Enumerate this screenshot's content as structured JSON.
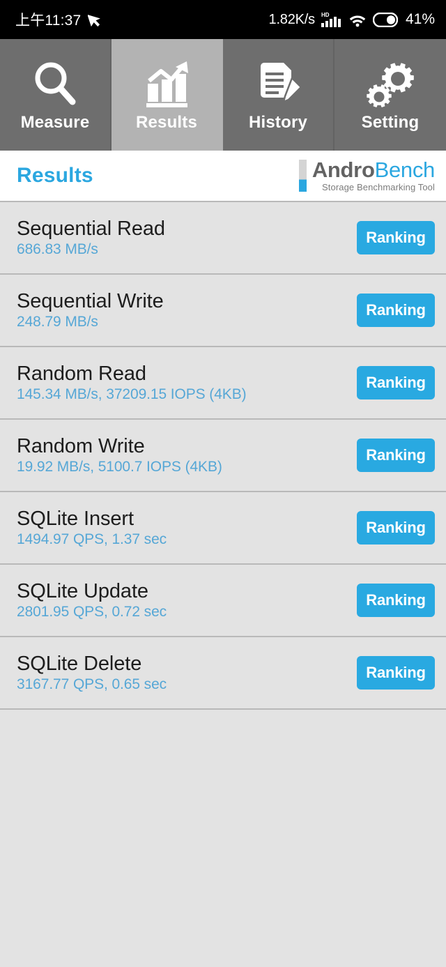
{
  "status_bar": {
    "time": "上午11:37",
    "cursor_icon": "cursor-arrow-icon",
    "net_speed": "1.82K/s",
    "signal_icon": "hd-signal-icon",
    "signal_label": "HD",
    "wifi_icon": "wifi-icon",
    "battery_icon": "battery-icon",
    "battery_percent": "41%"
  },
  "tabs": [
    {
      "label": "Measure",
      "icon": "magnifier-icon",
      "active": false
    },
    {
      "label": "Results",
      "icon": "bar-chart-icon",
      "active": true
    },
    {
      "label": "History",
      "icon": "document-pencil-icon",
      "active": false
    },
    {
      "label": "Setting",
      "icon": "gears-icon",
      "active": false
    }
  ],
  "header": {
    "title": "Results",
    "brand_first": "Andro",
    "brand_second": "Bench",
    "brand_tagline": "Storage Benchmarking Tool"
  },
  "colors": {
    "accent_blue": "#29a9e1",
    "subtext_blue": "#56a7d6",
    "tab_bg": "#6e6e6e",
    "tab_active_bg": "#b3b3b3",
    "list_bg": "#e3e3e3",
    "divider": "#b9b9b9",
    "brand_gray": "#636363"
  },
  "results": [
    {
      "name": "Sequential Read",
      "value": "686.83 MB/s",
      "button": "Ranking"
    },
    {
      "name": "Sequential Write",
      "value": "248.79 MB/s",
      "button": "Ranking"
    },
    {
      "name": "Random Read",
      "value": "145.34 MB/s, 37209.15 IOPS (4KB)",
      "button": "Ranking"
    },
    {
      "name": "Random Write",
      "value": "19.92 MB/s, 5100.7 IOPS (4KB)",
      "button": "Ranking"
    },
    {
      "name": "SQLite Insert",
      "value": "1494.97 QPS, 1.37 sec",
      "button": "Ranking"
    },
    {
      "name": "SQLite Update",
      "value": "2801.95 QPS, 0.72 sec",
      "button": "Ranking"
    },
    {
      "name": "SQLite Delete",
      "value": "3167.77 QPS, 0.65 sec",
      "button": "Ranking"
    }
  ]
}
